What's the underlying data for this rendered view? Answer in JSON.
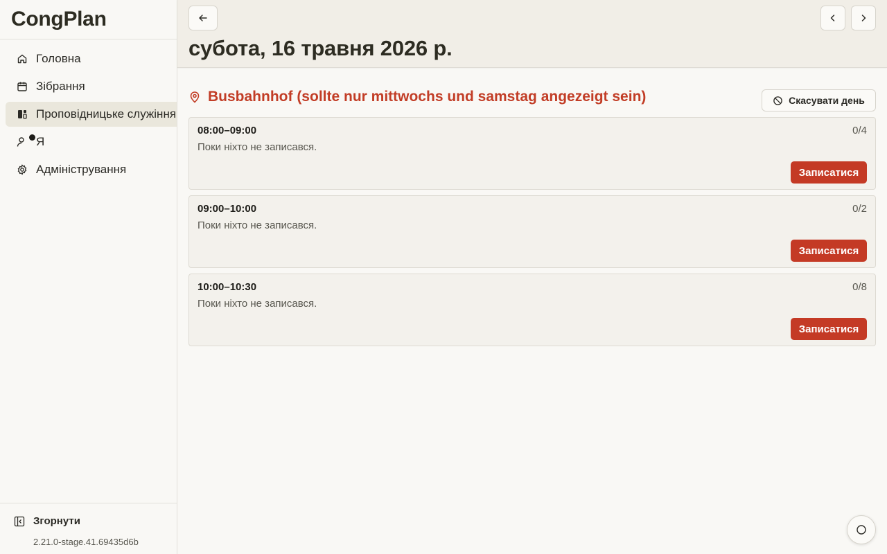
{
  "app": {
    "name": "CongPlan",
    "version": "2.21.0-stage.41.69435d6b"
  },
  "sidebar": {
    "items": [
      {
        "label": "Головна",
        "icon": "home-icon"
      },
      {
        "label": "Зібрання",
        "icon": "calendar-icon"
      },
      {
        "label": "Проповідницьке служіння",
        "icon": "ministry-icon",
        "active": true
      },
      {
        "label": "Я",
        "icon": "user-icon",
        "badge": true
      },
      {
        "label": "Адміністрування",
        "icon": "gear-icon"
      }
    ],
    "collapse_label": "Згорнути"
  },
  "header": {
    "title": "субота, 16 травня 2026 р."
  },
  "location": {
    "name": "Busbahnhof (sollte nur mittwochs und samstag angezeigt sein)",
    "cancel_label": "Скасувати день"
  },
  "slots": [
    {
      "time": "08:00–09:00",
      "count": "0/4",
      "empty_text": "Поки ніхто не записався.",
      "button": "Записатися"
    },
    {
      "time": "09:00–10:00",
      "count": "0/2",
      "empty_text": "Поки ніхто не записався.",
      "button": "Записатися"
    },
    {
      "time": "10:00–10:30",
      "count": "0/8",
      "empty_text": "Поки ніхто не записався.",
      "button": "Записатися"
    }
  ],
  "colors": {
    "accent": "#c43a25",
    "active_nav": "#eae7dc",
    "header_bg": "#f1eee7"
  }
}
